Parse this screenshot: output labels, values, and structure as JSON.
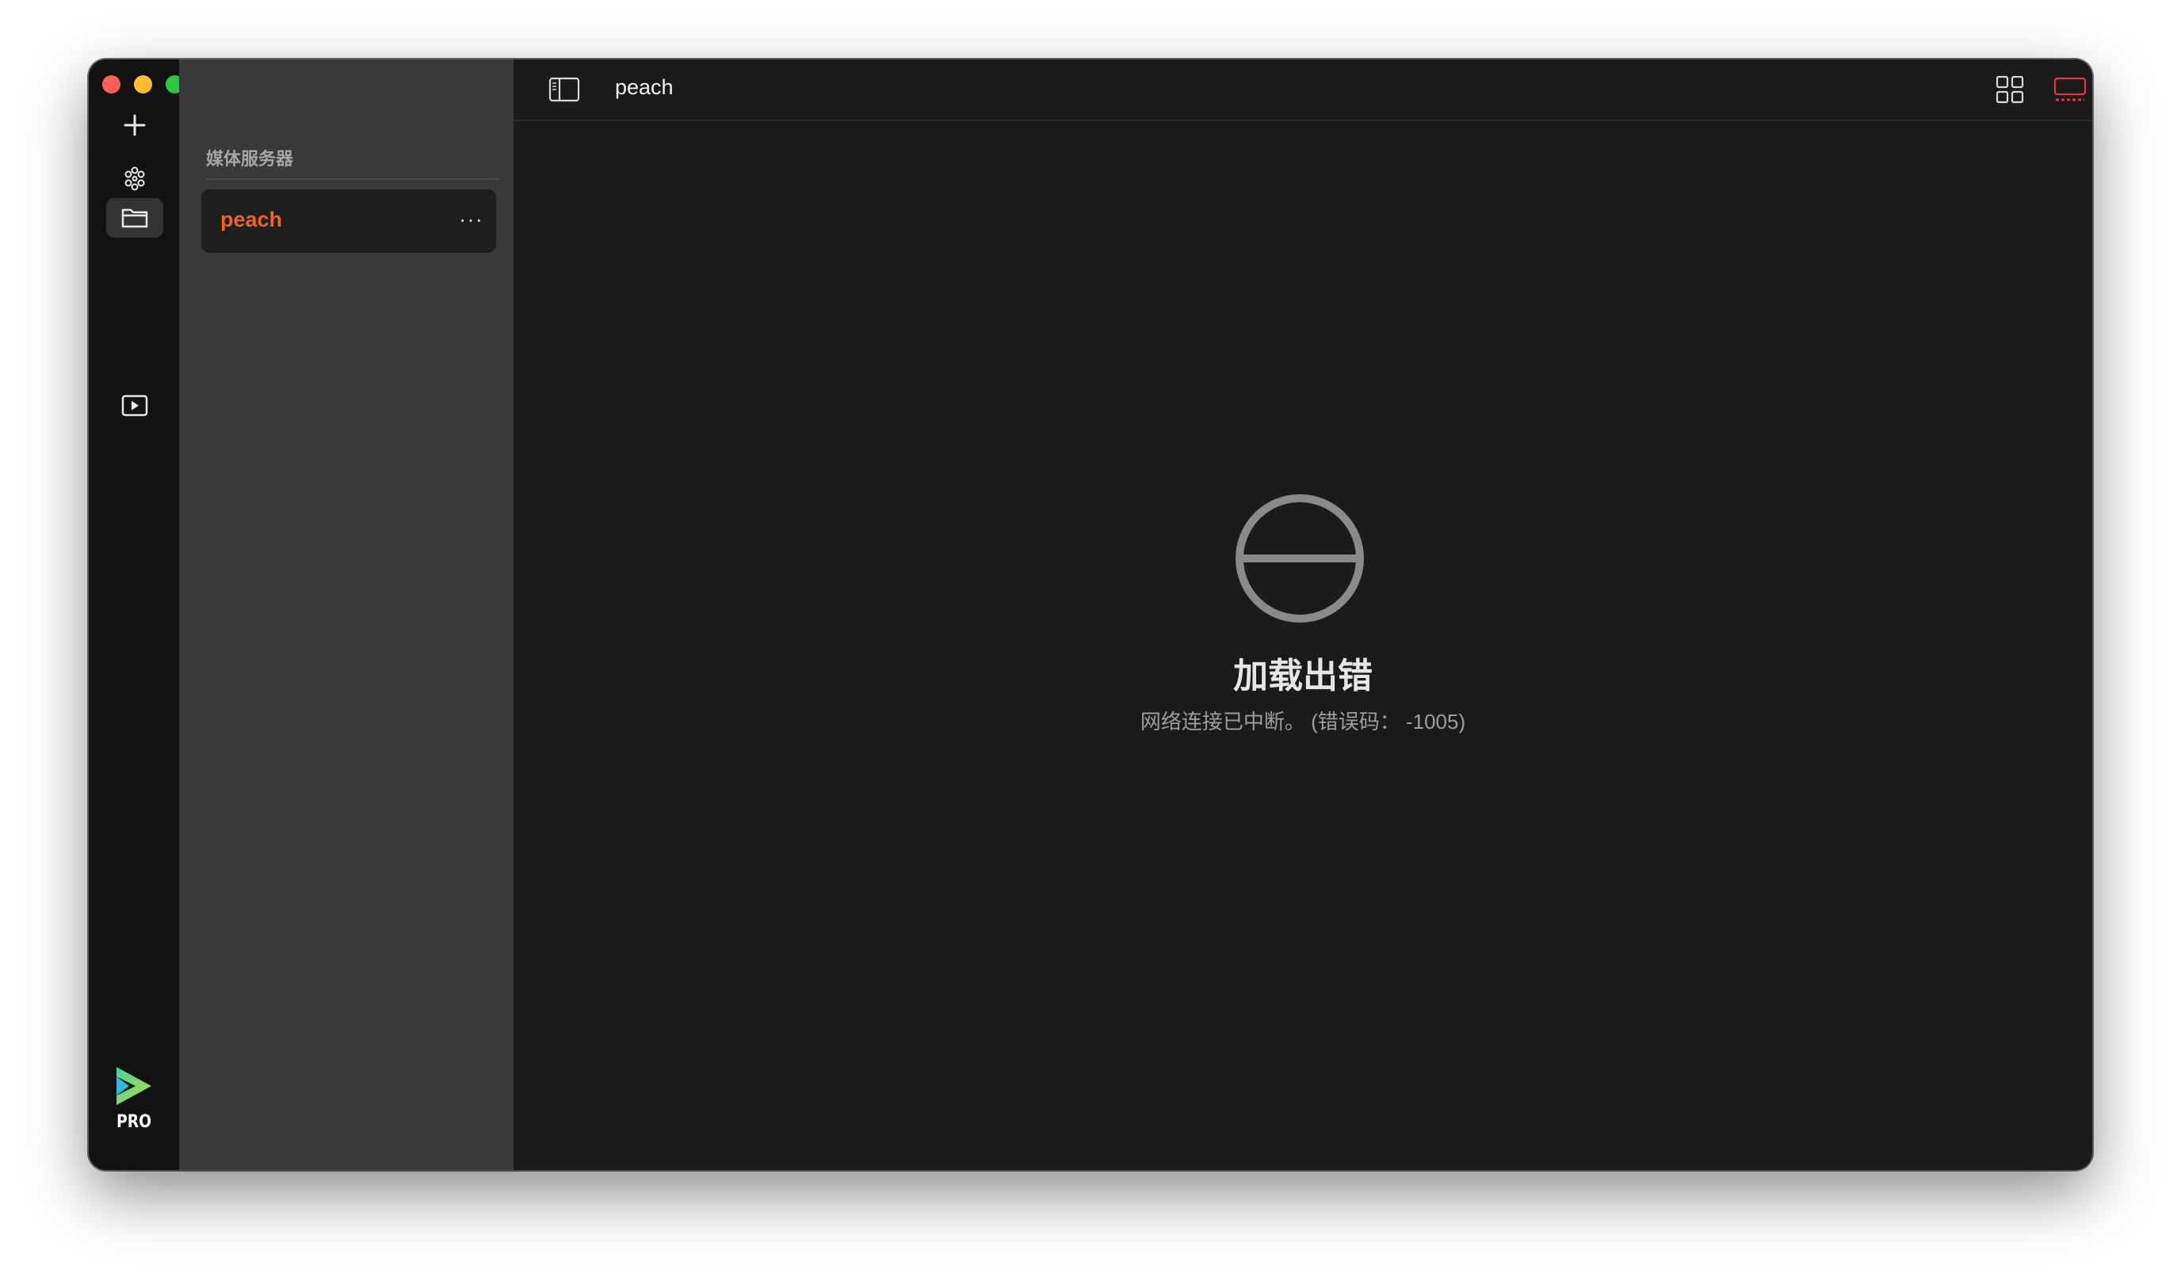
{
  "sidebar": {
    "section_title": "媒体服务器",
    "servers": [
      {
        "name": "peach",
        "more": "···"
      }
    ]
  },
  "rail": {
    "items": [
      {
        "icon": "plus-icon"
      },
      {
        "icon": "network-icon"
      },
      {
        "icon": "folder-icon",
        "active": true
      },
      {
        "icon": "play-icon"
      }
    ],
    "logo_text": "PRO"
  },
  "toolbar": {
    "title": "peach",
    "more": "···"
  },
  "error": {
    "title": "加载出错",
    "message": "网络连接已中断。 (错误码： -1005)"
  },
  "colors": {
    "accent": "#f0631e",
    "highlight_icon": "#e8363f",
    "close": "#ff5f57",
    "minimize": "#febc2e",
    "zoom": "#28c840"
  }
}
